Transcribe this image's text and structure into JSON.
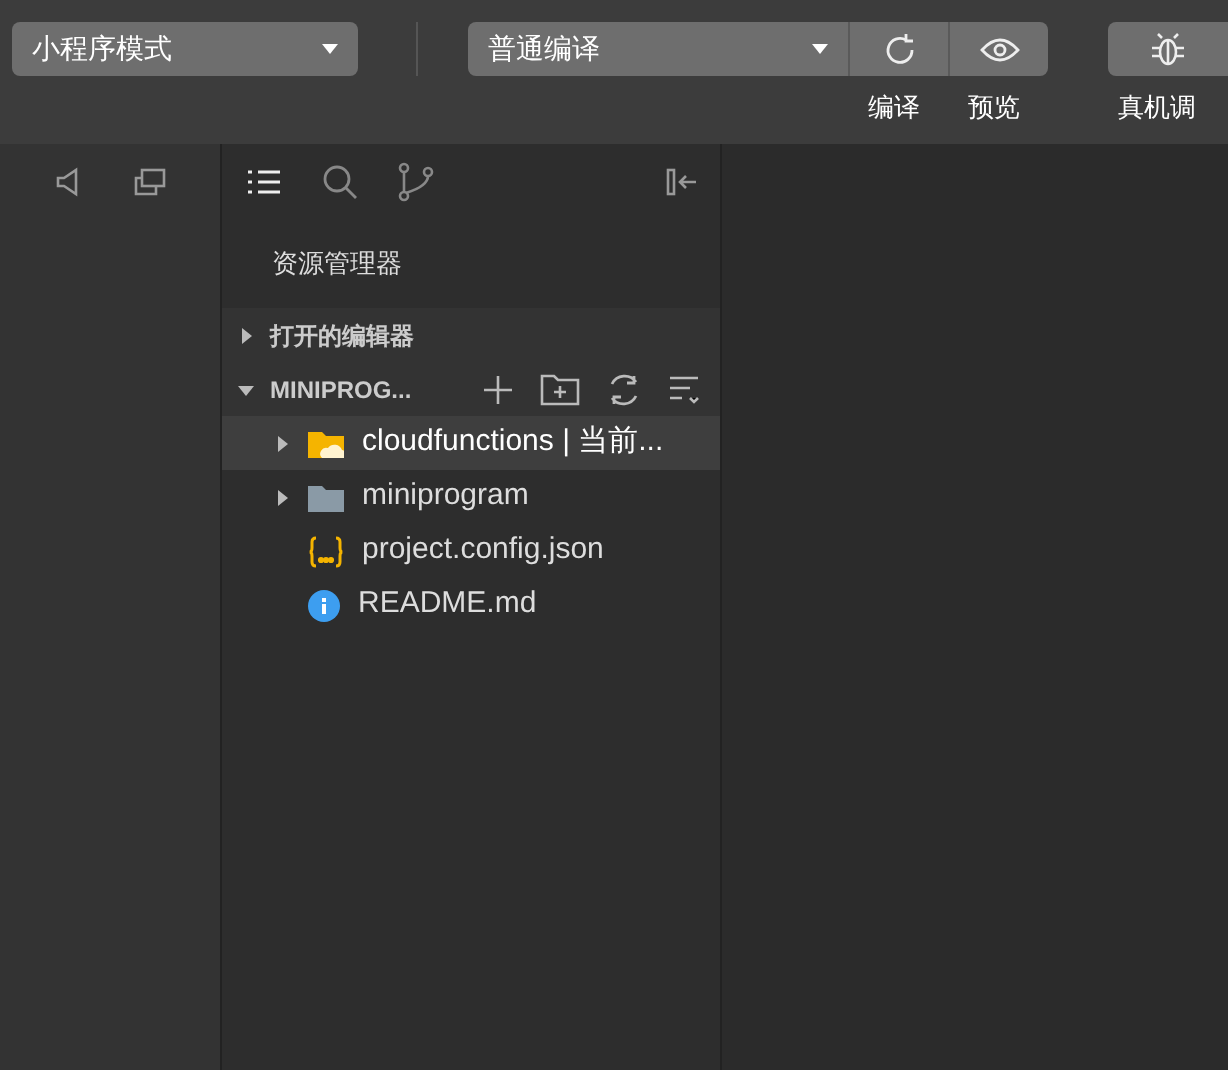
{
  "toolbar": {
    "mode_select": "小程序模式",
    "compile_select": "普通编译",
    "actions": [
      {
        "kind": "compile",
        "label": "编译"
      },
      {
        "kind": "preview",
        "label": "预览"
      },
      {
        "kind": "debug",
        "label": "真机调"
      }
    ]
  },
  "activity_bar": {
    "tools": [
      {
        "kind": "list",
        "selected": true
      },
      {
        "kind": "search",
        "selected": false
      },
      {
        "kind": "branch",
        "selected": false
      }
    ]
  },
  "explorer": {
    "title": "资源管理器",
    "sections": [
      {
        "label": "打开的编辑器",
        "expanded": false
      },
      {
        "label": "MINIPROG...",
        "expanded": true
      }
    ],
    "tree": [
      {
        "kind": "cloud-folder",
        "label": "cloudfunctions | 当前...",
        "expanded": false,
        "selected": true
      },
      {
        "kind": "folder",
        "label": "miniprogram",
        "expanded": false,
        "selected": false
      },
      {
        "kind": "json",
        "label": "project.config.json",
        "selected": false
      },
      {
        "kind": "info",
        "label": "README.md",
        "selected": false
      }
    ]
  }
}
